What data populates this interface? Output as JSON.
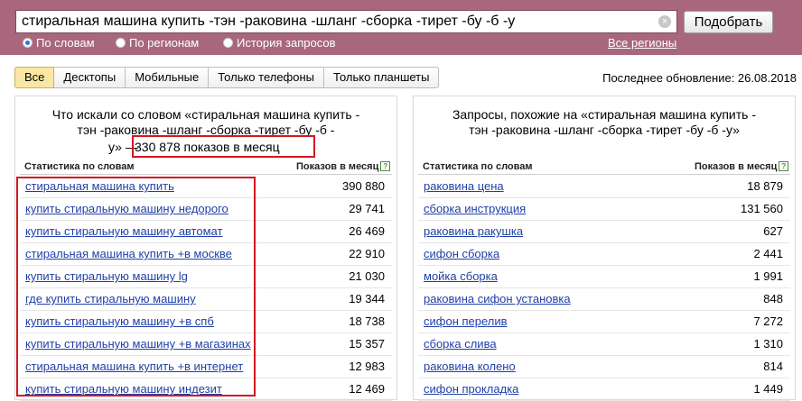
{
  "search": {
    "query": "стиральная машина купить -тэн -раковина -шланг -сборка -тирет -бу -б -у",
    "clear_glyph": "×",
    "submit_label": "Подобрать"
  },
  "modes": [
    {
      "label": "По словам",
      "selected": true
    },
    {
      "label": "По регионам",
      "selected": false
    },
    {
      "label": "История запросов",
      "selected": false
    }
  ],
  "all_regions": "Все регионы",
  "tabs": [
    "Все",
    "Десктопы",
    "Мобильные",
    "Только телефоны",
    "Только планшеты"
  ],
  "active_tab": "Все",
  "updated": "Последнее обновление: 26.08.2018",
  "left": {
    "title_line1": "Что искали со словом «стиральная машина купить -",
    "title_line2": "тэн -раковина -шланг -сборка -тирет -бу -б -",
    "title_line3_prefix": "у» —",
    "title_shows": "330 878 показов в месяц",
    "col_word": "Статистика по словам",
    "col_shows": "Показов в месяц",
    "help_glyph": "?",
    "rows": [
      {
        "kw": "стиральная машина купить",
        "n": "390 880"
      },
      {
        "kw": "купить стиральную машину недорого",
        "n": "29 741"
      },
      {
        "kw": "купить стиральную машину автомат",
        "n": "26 469"
      },
      {
        "kw": "стиральная машина купить +в москве",
        "n": "22 910"
      },
      {
        "kw": "купить стиральную машину lg",
        "n": "21 030"
      },
      {
        "kw": "где купить стиральную машину",
        "n": "19 344"
      },
      {
        "kw": "купить стиральную машину +в спб",
        "n": "18 738"
      },
      {
        "kw": "купить стиральную машину +в магазинах",
        "n": "15 357"
      },
      {
        "kw": "стиральная машина купить +в интернет",
        "n": "12 983"
      },
      {
        "kw": "купить стиральную машину индезит",
        "n": "12 469"
      }
    ]
  },
  "right": {
    "title_line1": "Запросы, похожие на «стиральная машина купить -",
    "title_line2": "тэн -раковина -шланг -сборка -тирет -бу -б -у»",
    "col_word": "Статистика по словам",
    "col_shows": "Показов в месяц",
    "help_glyph": "?",
    "rows": [
      {
        "kw": "раковина цена",
        "n": "18 879"
      },
      {
        "kw": "сборка инструкция",
        "n": "131 560"
      },
      {
        "kw": "раковина ракушка",
        "n": "627"
      },
      {
        "kw": "сифон сборка",
        "n": "2 441"
      },
      {
        "kw": "мойка сборка",
        "n": "1 991"
      },
      {
        "kw": "раковина сифон установка",
        "n": "848"
      },
      {
        "kw": "сифон перелив",
        "n": "7 272"
      },
      {
        "kw": "сборка слива",
        "n": "1 310"
      },
      {
        "kw": "раковина колено",
        "n": "814"
      },
      {
        "kw": "сифон прокладка",
        "n": "1 449"
      }
    ]
  },
  "colors": {
    "header_bg": "#a9677e",
    "link": "#1f3fa8",
    "annotation_red": "#d5161f",
    "active_tab": "#fbe7a4"
  }
}
